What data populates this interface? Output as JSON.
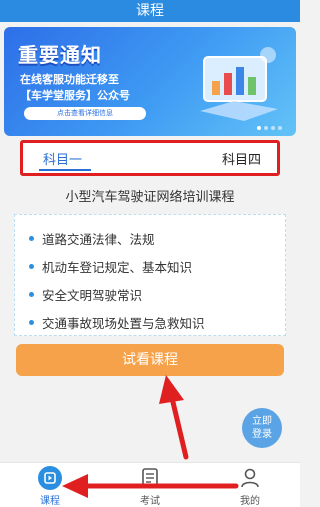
{
  "header": {
    "title": "课程"
  },
  "banner": {
    "title": "重要通知",
    "line1": "在线客服功能迁移至",
    "line2": "【车学堂服务】公众号",
    "button_label": "点击查看详细信息"
  },
  "tabs": [
    {
      "label": "科目一",
      "active": true
    },
    {
      "label": "科目四",
      "active": false
    }
  ],
  "course_title": "小型汽车驾驶证网络培训课程",
  "topics": [
    "道路交通法律、法规",
    "机动车登记规定、基本知识",
    "安全文明驾驶常识",
    "交通事故现场处置与急救知识"
  ],
  "trial_button": "试看课程",
  "login_float": {
    "line1": "立即",
    "line2": "登录"
  },
  "bottom_nav": [
    {
      "label": "课程",
      "icon": "course-icon",
      "active": true
    },
    {
      "label": "考试",
      "icon": "exam-icon",
      "active": false
    },
    {
      "label": "我的",
      "icon": "profile-icon",
      "active": false
    }
  ],
  "colors": {
    "header": "#2b8be0",
    "accent": "#2a6fd6",
    "trial_button": "#f6a24b",
    "annotation_red": "#e02020"
  }
}
